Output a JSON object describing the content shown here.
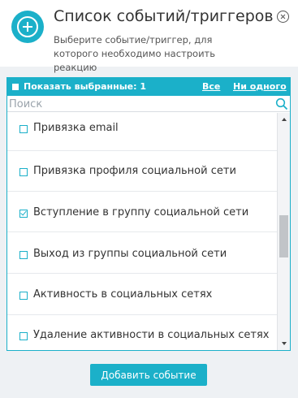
{
  "header": {
    "title": "Список событий/триггеров",
    "subtitle": "Выберите событие/триггер, для которого необходимо настроить реакцию",
    "add_icon": "plus-circle-icon",
    "close_icon": "close-circle-icon"
  },
  "toolbar": {
    "show_selected_label": "Показать выбранные: 1",
    "all_link": "Все",
    "none_link": "Ни одного"
  },
  "search": {
    "placeholder": "Поиск",
    "value": "",
    "icon": "search-icon"
  },
  "list": {
    "items": [
      {
        "label": "Привязка email",
        "checked": false
      },
      {
        "label": "Привязка профиля социальной сети",
        "checked": false
      },
      {
        "label": "Вступление в группу социальной сети",
        "checked": true
      },
      {
        "label": "Выход из группы социальной сети",
        "checked": false
      },
      {
        "label": "Активность в социальных сетях",
        "checked": false
      },
      {
        "label": "Удаление активности в социальных сетях",
        "checked": false
      }
    ]
  },
  "footer": {
    "add_event_label": "Добавить событие"
  },
  "colors": {
    "accent": "#1bb0c9",
    "background": "#eef1f4"
  }
}
